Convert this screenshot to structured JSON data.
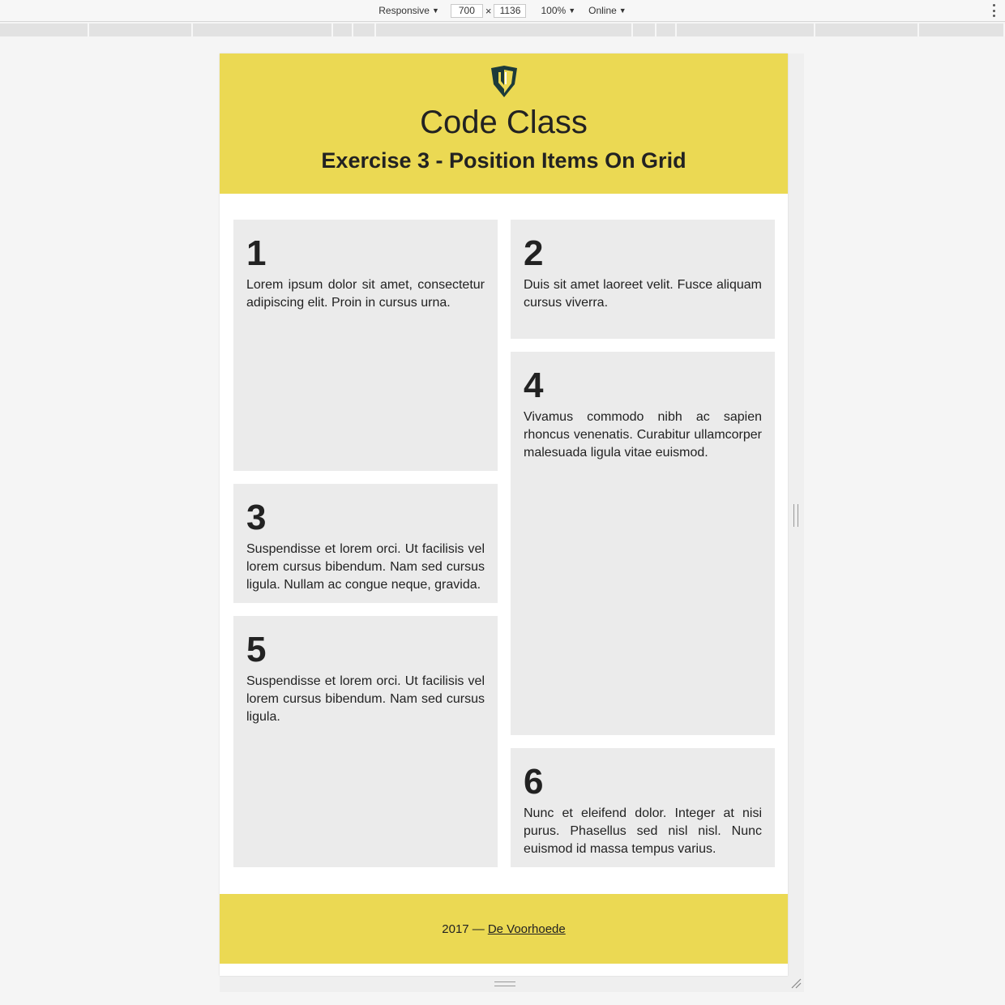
{
  "devtools": {
    "device_mode": "Responsive",
    "width": "700",
    "height": "1136",
    "dimension_separator": "×",
    "zoom": "100%",
    "throttling": "Online"
  },
  "site": {
    "title": "Code Class",
    "subtitle": "Exercise 3 - Position Items On Grid",
    "logo_icon": "shield-logo-icon",
    "colors": {
      "header_footer": "#ebd953",
      "card": "#ebebeb",
      "text": "#222222"
    }
  },
  "cards": [
    {
      "number": "1",
      "text": "Lorem ipsum dolor sit amet, consectetur adipiscing elit. Proin in cursus urna."
    },
    {
      "number": "2",
      "text": "Duis sit amet laoreet velit. Fusce aliquam cursus viverra."
    },
    {
      "number": "3",
      "text": "Suspendisse et lorem orci. Ut facilisis vel lorem cursus bibendum. Nam sed cursus ligula. Nullam ac congue neque, gravida."
    },
    {
      "number": "4",
      "text": "Vivamus commodo nibh ac sapien rhoncus venenatis. Curabitur ullamcorper malesuada ligula vitae euismod."
    },
    {
      "number": "5",
      "text": "Suspendisse et lorem orci. Ut facilisis vel lorem cursus bibendum. Nam sed cursus ligula."
    },
    {
      "number": "6",
      "text": "Nunc et eleifend dolor. Integer at nisi purus. Phasellus sed nisl nisl. Nunc euismod id massa tempus varius."
    }
  ],
  "footer": {
    "prefix": "2017 —",
    "link_text": "De Voorhoede"
  }
}
